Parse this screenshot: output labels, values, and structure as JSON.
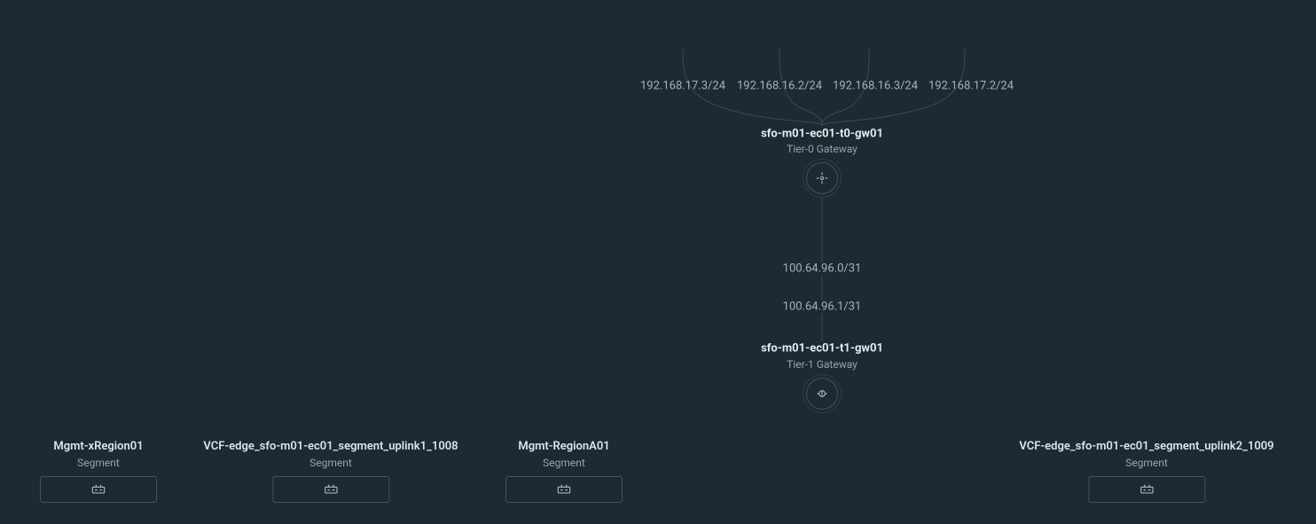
{
  "uplinks": [
    {
      "ip": "192.168.17.3/24"
    },
    {
      "ip": "192.168.16.2/24"
    },
    {
      "ip": "192.168.16.3/24"
    },
    {
      "ip": "192.168.17.2/24"
    }
  ],
  "tier0": {
    "name": "sfo-m01-ec01-t0-gw01",
    "type": "Tier-0 Gateway"
  },
  "link_t0_t1": {
    "top_ip": "100.64.96.0/31",
    "bottom_ip": "100.64.96.1/31"
  },
  "tier1": {
    "name": "sfo-m01-ec01-t1-gw01",
    "type": "Tier-1 Gateway"
  },
  "segments": [
    {
      "name": "Mgmt-xRegion01",
      "type": "Segment"
    },
    {
      "name": "VCF-edge_sfo-m01-ec01_segment_uplink1_1008",
      "type": "Segment"
    },
    {
      "name": "Mgmt-RegionA01",
      "type": "Segment"
    },
    {
      "name": "VCF-edge_sfo-m01-ec01_segment_uplink2_1009",
      "type": "Segment"
    }
  ]
}
